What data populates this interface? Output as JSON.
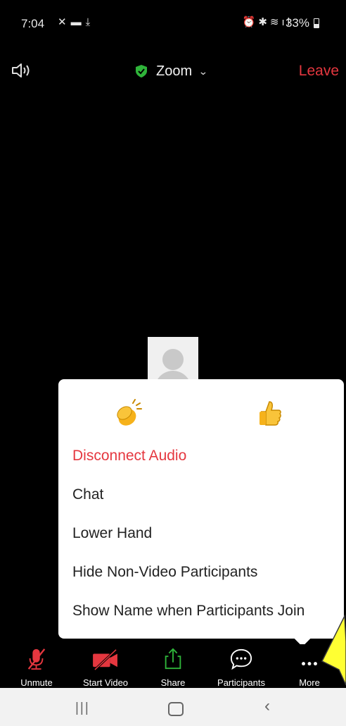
{
  "status_bar": {
    "time": "7:04",
    "battery": "33%"
  },
  "meeting": {
    "title": "Zoom",
    "leave_label": "Leave"
  },
  "reactions": [
    {
      "name": "clapping-hands",
      "icon": "clap-icon"
    },
    {
      "name": "thumbs-up",
      "icon": "thumbs-up-icon"
    }
  ],
  "menu": {
    "items": [
      "Disconnect Audio",
      "Chat",
      "Lower Hand",
      "Hide Non-Video Participants",
      "Show Name when Participants Join"
    ]
  },
  "toolbar": {
    "unmute": "Unmute",
    "start_video": "Start Video",
    "share": "Share",
    "participants": "Participants",
    "more": "More"
  },
  "colors": {
    "accent_red": "#e5373f",
    "share_green": "#2fb43a",
    "highlight_yellow": "#ffff33"
  }
}
